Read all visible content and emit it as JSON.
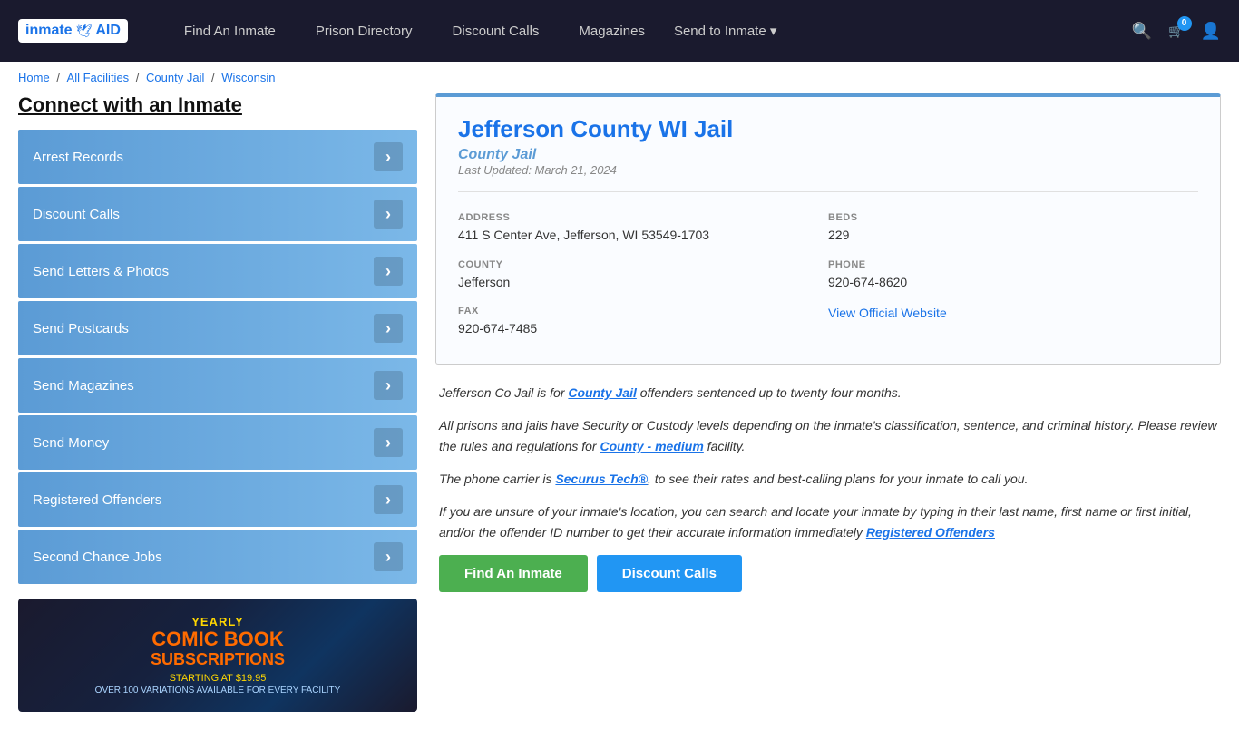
{
  "nav": {
    "logo_text": "inmateAID",
    "links": [
      {
        "label": "Find An Inmate",
        "id": "find-inmate"
      },
      {
        "label": "Prison Directory",
        "id": "prison-directory"
      },
      {
        "label": "Discount Calls",
        "id": "discount-calls"
      },
      {
        "label": "Magazines",
        "id": "magazines"
      },
      {
        "label": "Send to Inmate ▾",
        "id": "send-to-inmate"
      }
    ],
    "cart_count": "0",
    "search_title": "Search",
    "cart_title": "Cart",
    "user_title": "Account"
  },
  "breadcrumb": {
    "home": "Home",
    "all_facilities": "All Facilities",
    "county_jail": "County Jail",
    "wisconsin": "Wisconsin"
  },
  "sidebar": {
    "title": "Connect with an Inmate",
    "items": [
      {
        "label": "Arrest Records"
      },
      {
        "label": "Discount Calls"
      },
      {
        "label": "Send Letters & Photos"
      },
      {
        "label": "Send Postcards"
      },
      {
        "label": "Send Magazines"
      },
      {
        "label": "Send Money"
      },
      {
        "label": "Registered Offenders"
      },
      {
        "label": "Second Chance Jobs"
      }
    ]
  },
  "ad": {
    "yearly": "YEARLY",
    "comic": "COMIC BOOK",
    "subscriptions": "SUBSCRIPTIONS",
    "starting": "STARTING AT $19.95",
    "over": "OVER 100 VARIATIONS AVAILABLE FOR EVERY FACILITY"
  },
  "facility": {
    "name": "Jefferson County WI Jail",
    "type": "County Jail",
    "last_updated": "Last Updated: March 21, 2024",
    "address_label": "ADDRESS",
    "address_value": "411 S Center Ave, Jefferson, WI 53549-1703",
    "beds_label": "BEDS",
    "beds_value": "229",
    "county_label": "COUNTY",
    "county_value": "Jefferson",
    "phone_label": "PHONE",
    "phone_value": "920-674-8620",
    "fax_label": "FAX",
    "fax_value": "920-674-7485",
    "website_label": "View Official Website",
    "website_url": "#"
  },
  "description": {
    "para1_start": "Jefferson Co Jail is for ",
    "para1_highlight": "County Jail",
    "para1_end": " offenders sentenced up to twenty four months.",
    "para2": "All prisons and jails have Security or Custody levels depending on the inmate's classification, sentence, and criminal history. Please review the rules and regulations for ",
    "para2_highlight": "County - medium",
    "para2_end": " facility.",
    "para3_start": "The phone carrier is ",
    "para3_highlight": "Securus Tech®",
    "para3_end": ", to see their rates and best-calling plans for your inmate to call you.",
    "para4_start": "If you are unsure of your inmate's location, you can search and locate your inmate by typing in their last name, first name or first initial, and/or the offender ID number to get their accurate information immediately ",
    "para4_highlight": "Registered Offenders"
  },
  "buttons": {
    "btn1": "Find An Inmate",
    "btn2": "Discount Calls"
  }
}
